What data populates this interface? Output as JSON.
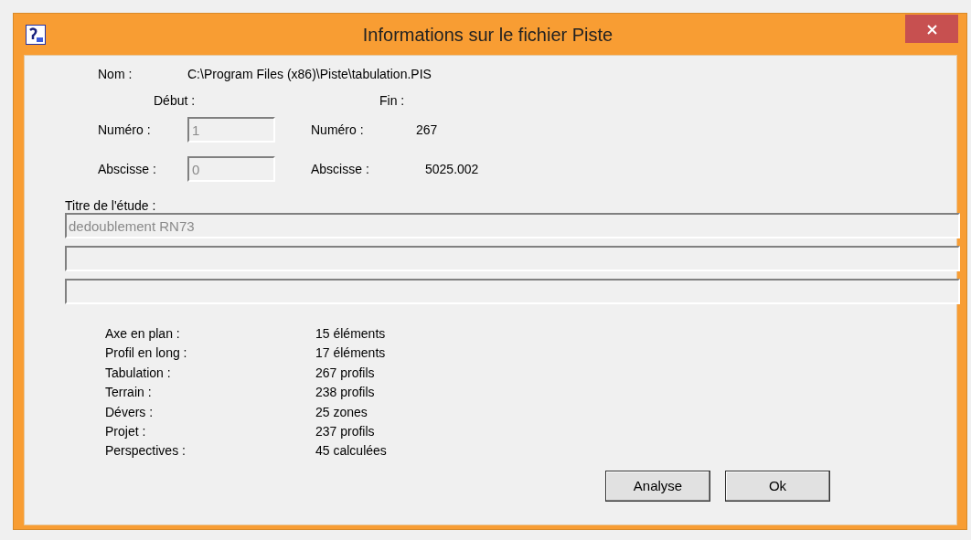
{
  "window": {
    "title": "Informations sur le fichier Piste"
  },
  "nom": {
    "label": "Nom :",
    "value": "C:\\Program Files (x86)\\Piste\\tabulation.PIS"
  },
  "debut": {
    "heading": "Début :",
    "numero": {
      "label": "Numéro :",
      "value": "1",
      "disabled": true
    },
    "abscisse": {
      "label": "Abscisse :",
      "value": "0",
      "disabled": true
    }
  },
  "fin": {
    "heading": "Fin :",
    "numero": {
      "label": "Numéro :",
      "value": "267"
    },
    "abscisse": {
      "label": "Abscisse :",
      "value": "5025.002"
    }
  },
  "titre": {
    "label": "Titre de l'étude :",
    "lines": [
      {
        "value": "dedoublement RN73",
        "disabled": true
      },
      {
        "disabled": true
      },
      {
        "disabled": true
      }
    ]
  },
  "stats": [
    {
      "label": "Axe en plan :",
      "value": "15 éléments"
    },
    {
      "label": "Profil en long :",
      "value": "17 éléments"
    },
    {
      "label": "Tabulation :",
      "value": "267 profils"
    },
    {
      "label": "Terrain :",
      "value": "238 profils"
    },
    {
      "label": "Dévers :",
      "value": "25 zones"
    },
    {
      "label": "Projet :",
      "value": "237 profils"
    },
    {
      "label": "Perspectives :",
      "value": "45 calculées"
    }
  ],
  "buttons": [
    "Analyse",
    "Ok"
  ]
}
